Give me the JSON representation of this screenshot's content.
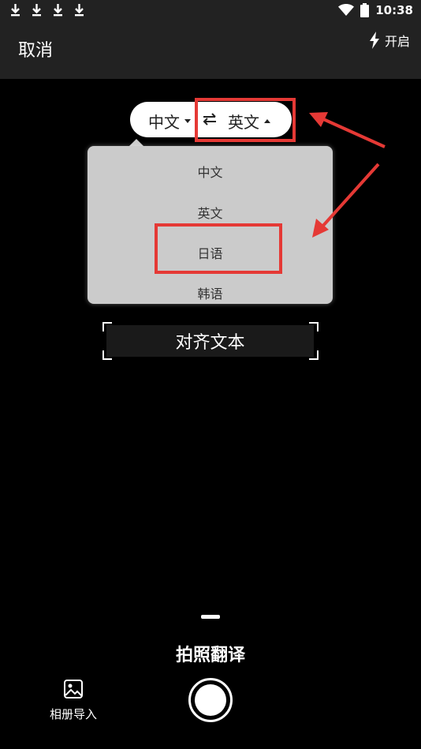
{
  "status_bar": {
    "time": "10:38",
    "icons": [
      "download-icon",
      "download-icon",
      "download-icon",
      "download-icon",
      "wifi-icon",
      "battery-icon"
    ]
  },
  "top_bar": {
    "cancel_label": "取消",
    "flash_label": "开启",
    "flash_icon": "lightning-icon"
  },
  "language_selector": {
    "source": "中文",
    "target": "英文",
    "swap_icon": "swap-arrows-icon"
  },
  "dropdown": {
    "items": [
      "中文",
      "英文",
      "日语",
      "韩语"
    ],
    "highlighted": "日语"
  },
  "camera": {
    "align_text": "对齐文本"
  },
  "bottom": {
    "mode_label": "拍照翻译",
    "album_label": "相册导入",
    "album_icon": "image-icon"
  },
  "colors": {
    "annotation_red": "#e53935",
    "dropdown_bg": "#cbcbcb",
    "bar_bg": "#222222"
  }
}
